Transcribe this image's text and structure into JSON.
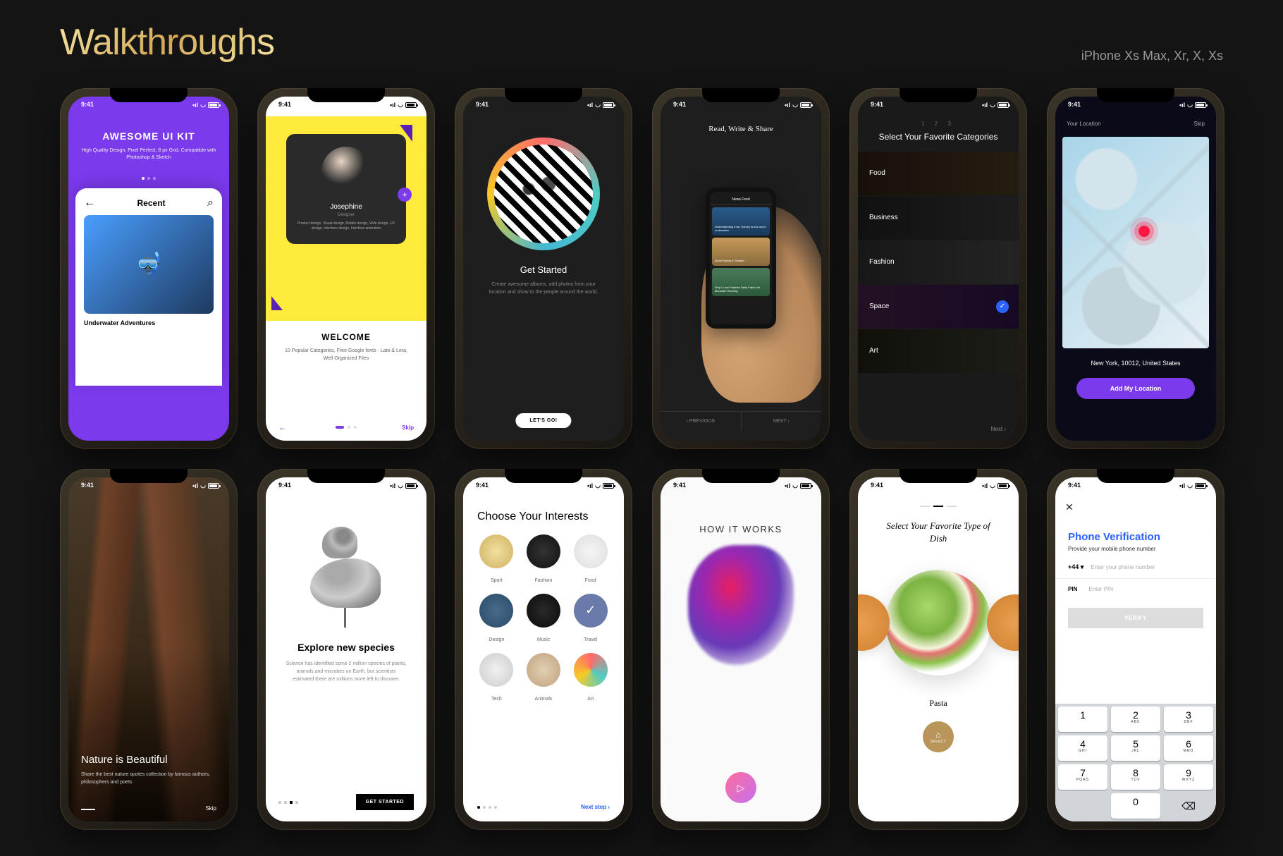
{
  "header": {
    "title": "Walkthroughs",
    "devices": "iPhone Xs Max, Xr, X, Xs"
  },
  "status": {
    "time": "9:41"
  },
  "s1": {
    "title": "AWESOME UI KIT",
    "sub": "High Quality Design, Pixel Perfect, 8 px Grid, Compatible with Photoshop & Sketch",
    "recent": "Recent",
    "card": "Underwater Adventures"
  },
  "s2": {
    "name": "Josephine",
    "role": "Designer",
    "desc": "Product design, Visual design, Mobile design, Web design, UX design, Interface design, Interface animation",
    "welcome": "WELCOME",
    "welcomeSub": "10 Popular Categories, Free Google fonts - Lato & Lora, Well Organized Files",
    "skip": "Skip"
  },
  "s3": {
    "title": "Get Started",
    "sub": "Create awesome albums, add photos from your location and show to the people around the world.",
    "btn": "LET'S GO!"
  },
  "s4": {
    "title": "Read, Write & Share",
    "feed": "News Feed",
    "c1": "Understanding Irma, Harvey and a world underwater",
    "c2": "Quad Racing in Sahara",
    "c3": "Why I Love Polartec Delta Fabric for Mountain Running",
    "prev": "PREVIOUS",
    "next": "NEXT"
  },
  "s5": {
    "pager": "1   2   3",
    "title": "Select Your Favorite Categories",
    "cats": [
      "Food",
      "Business",
      "Fashion",
      "Space",
      "Art"
    ],
    "next": "Next ›"
  },
  "s6": {
    "yourLoc": "Your Location",
    "skip": "Skip",
    "loc": "New York, 10012, United States",
    "btn": "Add My Location"
  },
  "s7": {
    "title": "Nature is Beautiful",
    "sub": "Share the best nature quotes collection by famous authors, philosophers and poets",
    "skip": "Skip"
  },
  "s8": {
    "title": "Explore new species",
    "sub": "Science has identified some 2 million species of plants, animals and microbes on Earth, but scientists estimated there are millions more left to discover.",
    "btn": "GET STARTED"
  },
  "s9": {
    "title": "Choose Your Interests",
    "items": [
      "Sport",
      "Fashion",
      "Food",
      "Design",
      "Music",
      "Travel",
      "Tech",
      "Animals",
      "Art"
    ],
    "next": "Next step ›"
  },
  "s10": {
    "title": "HOW IT WORKS"
  },
  "s11": {
    "title": "Select Your Favorite Type of Dish",
    "label": "Pasta",
    "select": "SELECT"
  },
  "s12": {
    "title": "Phone Verification",
    "sub": "Provide your mobile phone number",
    "cc": "+44 ▾",
    "ph": "Enter your phone number",
    "pin": "PIN",
    "pinPh": "Enter PIN",
    "verify": "VERIFY",
    "keys": [
      {
        "n": "1",
        "l": ""
      },
      {
        "n": "2",
        "l": "ABC"
      },
      {
        "n": "3",
        "l": "DEF"
      },
      {
        "n": "4",
        "l": "GHI"
      },
      {
        "n": "5",
        "l": "JKL"
      },
      {
        "n": "6",
        "l": "MNO"
      },
      {
        "n": "7",
        "l": "PQRS"
      },
      {
        "n": "8",
        "l": "TUV"
      },
      {
        "n": "9",
        "l": "WXYZ"
      }
    ],
    "zero": {
      "n": "0",
      "l": ""
    }
  }
}
